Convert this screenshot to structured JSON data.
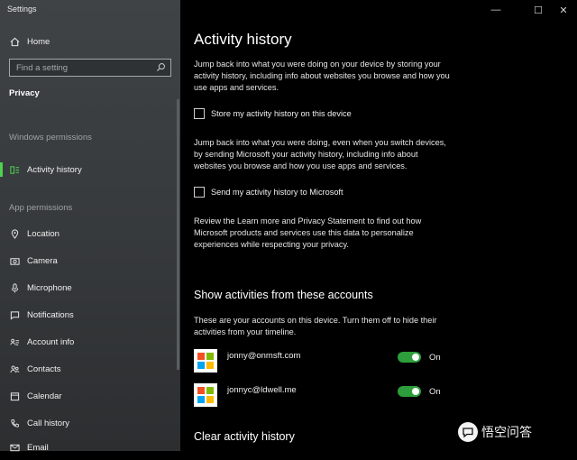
{
  "window": {
    "title": "Settings",
    "controls": {
      "minimize": "—",
      "maximize": "☐",
      "close": "✕"
    }
  },
  "sidebar": {
    "home": "Home",
    "search_placeholder": "Find a setting",
    "category": "Privacy",
    "windows_permissions_header": "Windows permissions",
    "activity_history": "Activity history",
    "app_permissions_header": "App permissions",
    "items": [
      {
        "label": "Location",
        "icon": "location-icon"
      },
      {
        "label": "Camera",
        "icon": "camera-icon"
      },
      {
        "label": "Microphone",
        "icon": "microphone-icon"
      },
      {
        "label": "Notifications",
        "icon": "notifications-icon"
      },
      {
        "label": "Account info",
        "icon": "account-info-icon"
      },
      {
        "label": "Contacts",
        "icon": "contacts-icon"
      },
      {
        "label": "Calendar",
        "icon": "calendar-icon"
      },
      {
        "label": "Call history",
        "icon": "call-history-icon"
      },
      {
        "label": "Email",
        "icon": "email-icon"
      }
    ]
  },
  "main": {
    "title": "Activity history",
    "intro": "Jump back into what you were doing on your device by storing your activity history, including info about websites you browse and how you use apps and services.",
    "store_checkbox": "Store my activity history on this device",
    "send_intro": "Jump back into what you were doing, even when you switch devices, by sending Microsoft your activity history, including info about websites you browse and how you use apps and services.",
    "send_checkbox": "Send my activity history to Microsoft",
    "review_text": "Review the Learn more and Privacy Statement to find out how Microsoft products and services use this data to personalize experiences while respecting your privacy.",
    "accounts_heading": "Show activities from these accounts",
    "accounts_desc": "These are your accounts on this device. Turn them off to hide their activities from your timeline.",
    "accounts": [
      {
        "email": "jonny@onmsft.com",
        "state": "On"
      },
      {
        "email": "jonnyc@ldwell.me",
        "state": "On"
      }
    ],
    "clear_heading": "Clear activity history"
  },
  "watermark": {
    "text": "悟空问答"
  },
  "colors": {
    "accent": "#4fd14f",
    "toggle_on": "#2e9e3c"
  }
}
